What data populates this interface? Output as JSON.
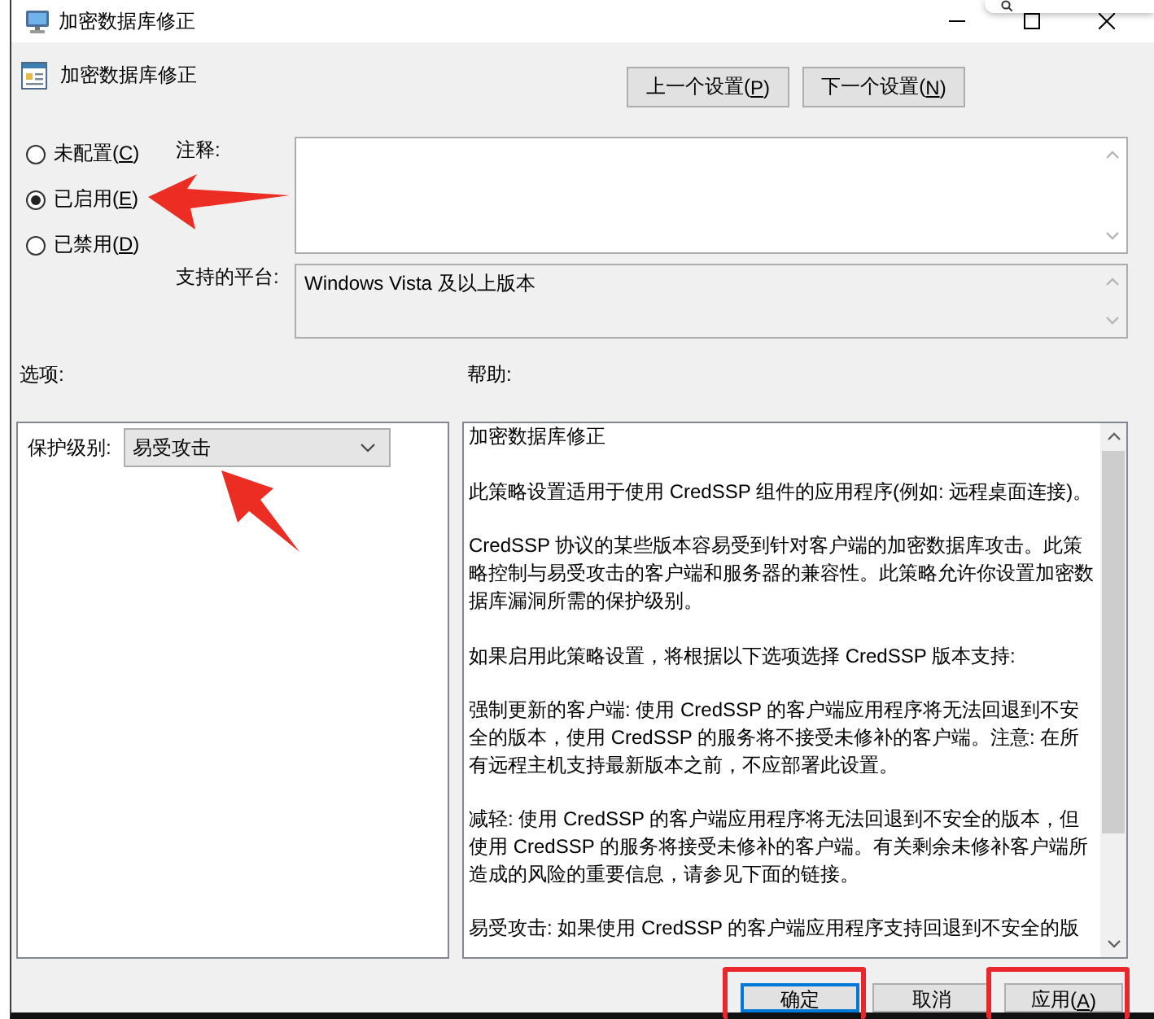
{
  "window": {
    "title": "加密数据库修正"
  },
  "header": {
    "title": "加密数据库修正",
    "buttons": [
      {
        "label": "上一个设置(P)",
        "access_key": true
      },
      {
        "label": "下一个设置(N)",
        "access_key": true
      }
    ]
  },
  "state_options": [
    {
      "label": "未配置(C)",
      "access_key": true,
      "selected": false,
      "callout": false
    },
    {
      "label": "已启用(E)",
      "access_key": true,
      "selected": true,
      "callout": true
    },
    {
      "label": "已禁用(D)",
      "access_key": true,
      "selected": false,
      "callout": false
    }
  ],
  "comment": {
    "label": "注释:"
  },
  "supported_on": {
    "label": "支持的平台:",
    "value": "Windows Vista 及以上版本"
  },
  "options": {
    "label": "选项:",
    "fields": [
      {
        "label": "保护级别:",
        "value": "易受攻击",
        "callout": true
      }
    ]
  },
  "help": {
    "label": "帮助:",
    "paragraphs": [
      "加密数据库修正",
      "此策略设置适用于使用 CredSSP 组件的应用程序(例如: 远程桌面连接)。",
      "CredSSP 协议的某些版本容易受到针对客户端的加密数据库攻击。此策略控制与易受攻击的客户端和服务器的兼容性。此策略允许你设置加密数据库漏洞所需的保护级别。",
      "如果启用此策略设置，将根据以下选项选择 CredSSP 版本支持:",
      "强制更新的客户端: 使用 CredSSP 的客户端应用程序将无法回退到不安全的版本，使用 CredSSP 的服务将不接受未修补的客户端。注意: 在所有远程主机支持最新版本之前，不应部署此设置。",
      "减轻: 使用 CredSSP 的客户端应用程序将无法回退到不安全的版本，但使用 CredSSP 的服务将接受未修补的客户端。有关剩余未修补客户端所造成的风险的重要信息，请参见下面的链接。",
      "易受攻击: 如果使用 CredSSP 的客户端应用程序支持回退到不安全的版"
    ]
  },
  "buttons": [
    {
      "label": "确定",
      "focused": true,
      "highlighted": true
    },
    {
      "label": "取消",
      "focused": false,
      "highlighted": false
    },
    {
      "label": "应用(A)",
      "access_key": true,
      "focused": false,
      "highlighted": true
    }
  ]
}
